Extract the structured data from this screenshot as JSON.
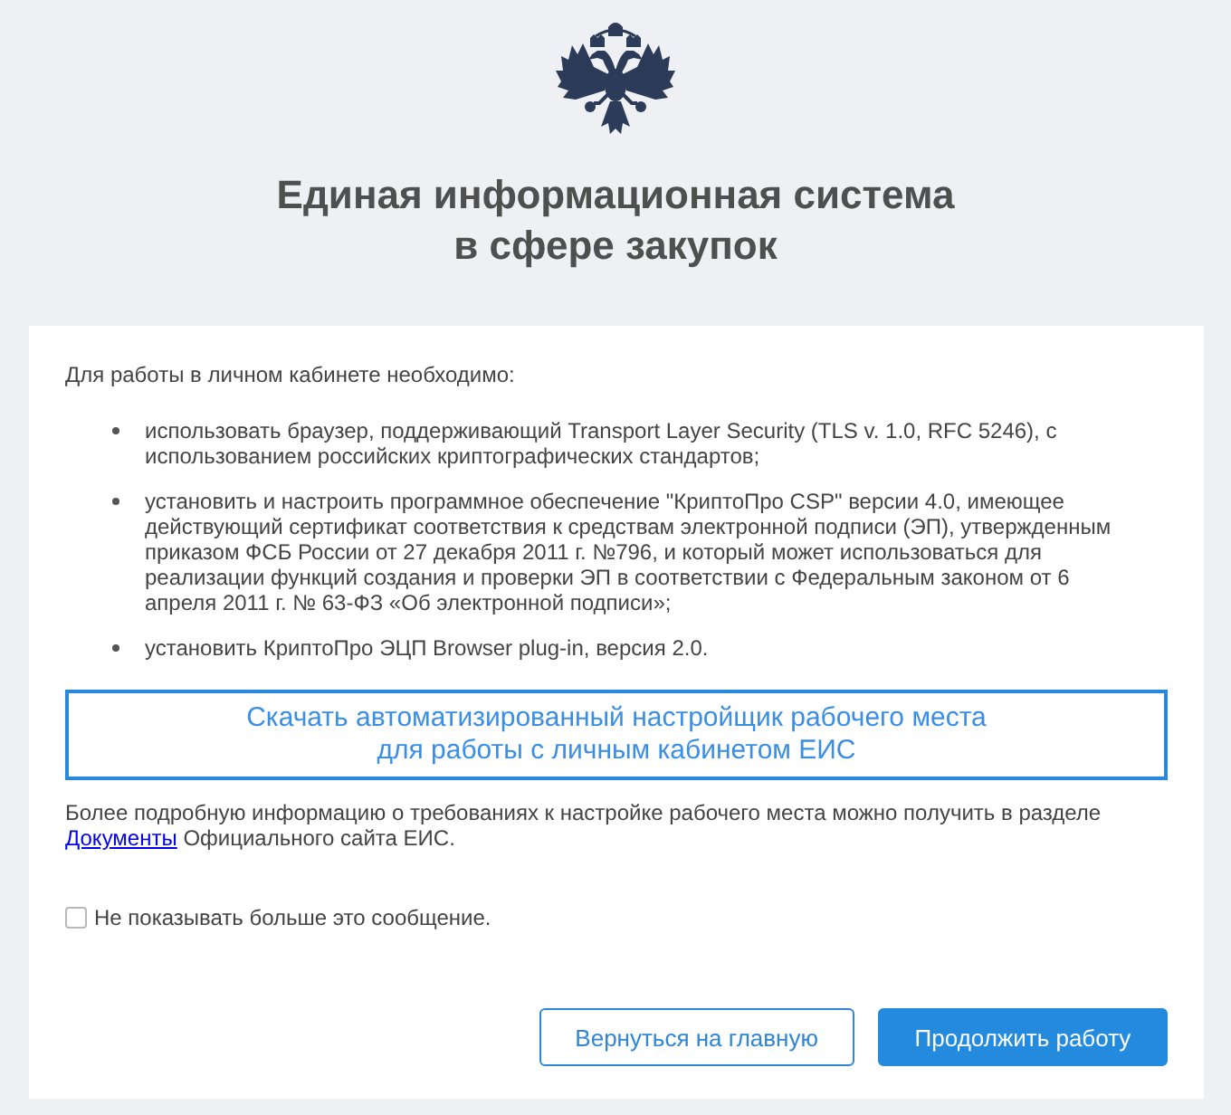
{
  "header": {
    "title_lines": [
      "Единая информационная система",
      "в сфере закупок"
    ]
  },
  "notice": {
    "intro": "Для работы в личном кабинете необходимо:",
    "requirements": [
      "использовать браузер, поддерживающий Transport Layer Security (TLS v. 1.0, RFC 5246), с использованием российских криптографических стандартов;",
      "установить и настроить программное обеспечение \"КриптоПро CSP\" версии 4.0, имеющее действующий сертификат соответствия к средствам электронной подписи (ЭП), утвержденным приказом ФСБ России от 27 декабря 2011 г. №796, и который может использоваться для реализации функций создания и проверки ЭП в соответствии с Федеральным законом от 6 апреля 2011 г. № 63-ФЗ «Об электронной подписи»;",
      "установить КриптоПро ЭЦП Browser plug-in, версия 2.0."
    ],
    "download_button": {
      "label_lines": [
        "Скачать автоматизированный настройщик рабочего места",
        "для работы с личным кабинетом ЕИС"
      ]
    },
    "more_info": {
      "text_before": "Более подробную информацию о требованиях к настройке рабочего места можно получить в разделе",
      "link": "Документы",
      "text_after": "Официального сайта ЕИС."
    },
    "dont_show_again": {
      "label": "Не показывать больше это сообщение.",
      "checked": false
    },
    "buttons": [
      {
        "label": "Вернуться на главную",
        "kind": "outline"
      },
      {
        "label": "Продолжить работу",
        "kind": "primary"
      }
    ]
  }
}
